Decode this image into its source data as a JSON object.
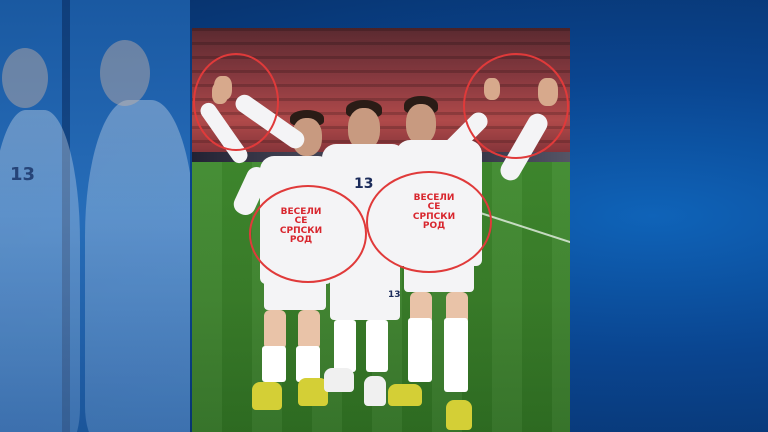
{
  "background": {
    "color": "#0a4590",
    "accent": "#0f63b8"
  },
  "left_echo": {
    "number_label": "13"
  },
  "photo": {
    "circle_color": "#e03a3a",
    "players": [
      {
        "shirt_text": "ВЕСЕЛИ СЕ\nСРПСКИ РОД",
        "number": ""
      },
      {
        "shirt_text": "",
        "number": "13",
        "shorts_number": "13"
      },
      {
        "shirt_text": "ВЕСЕЛИ СЕ\nСРПСКИ РОД",
        "number": ""
      }
    ]
  }
}
